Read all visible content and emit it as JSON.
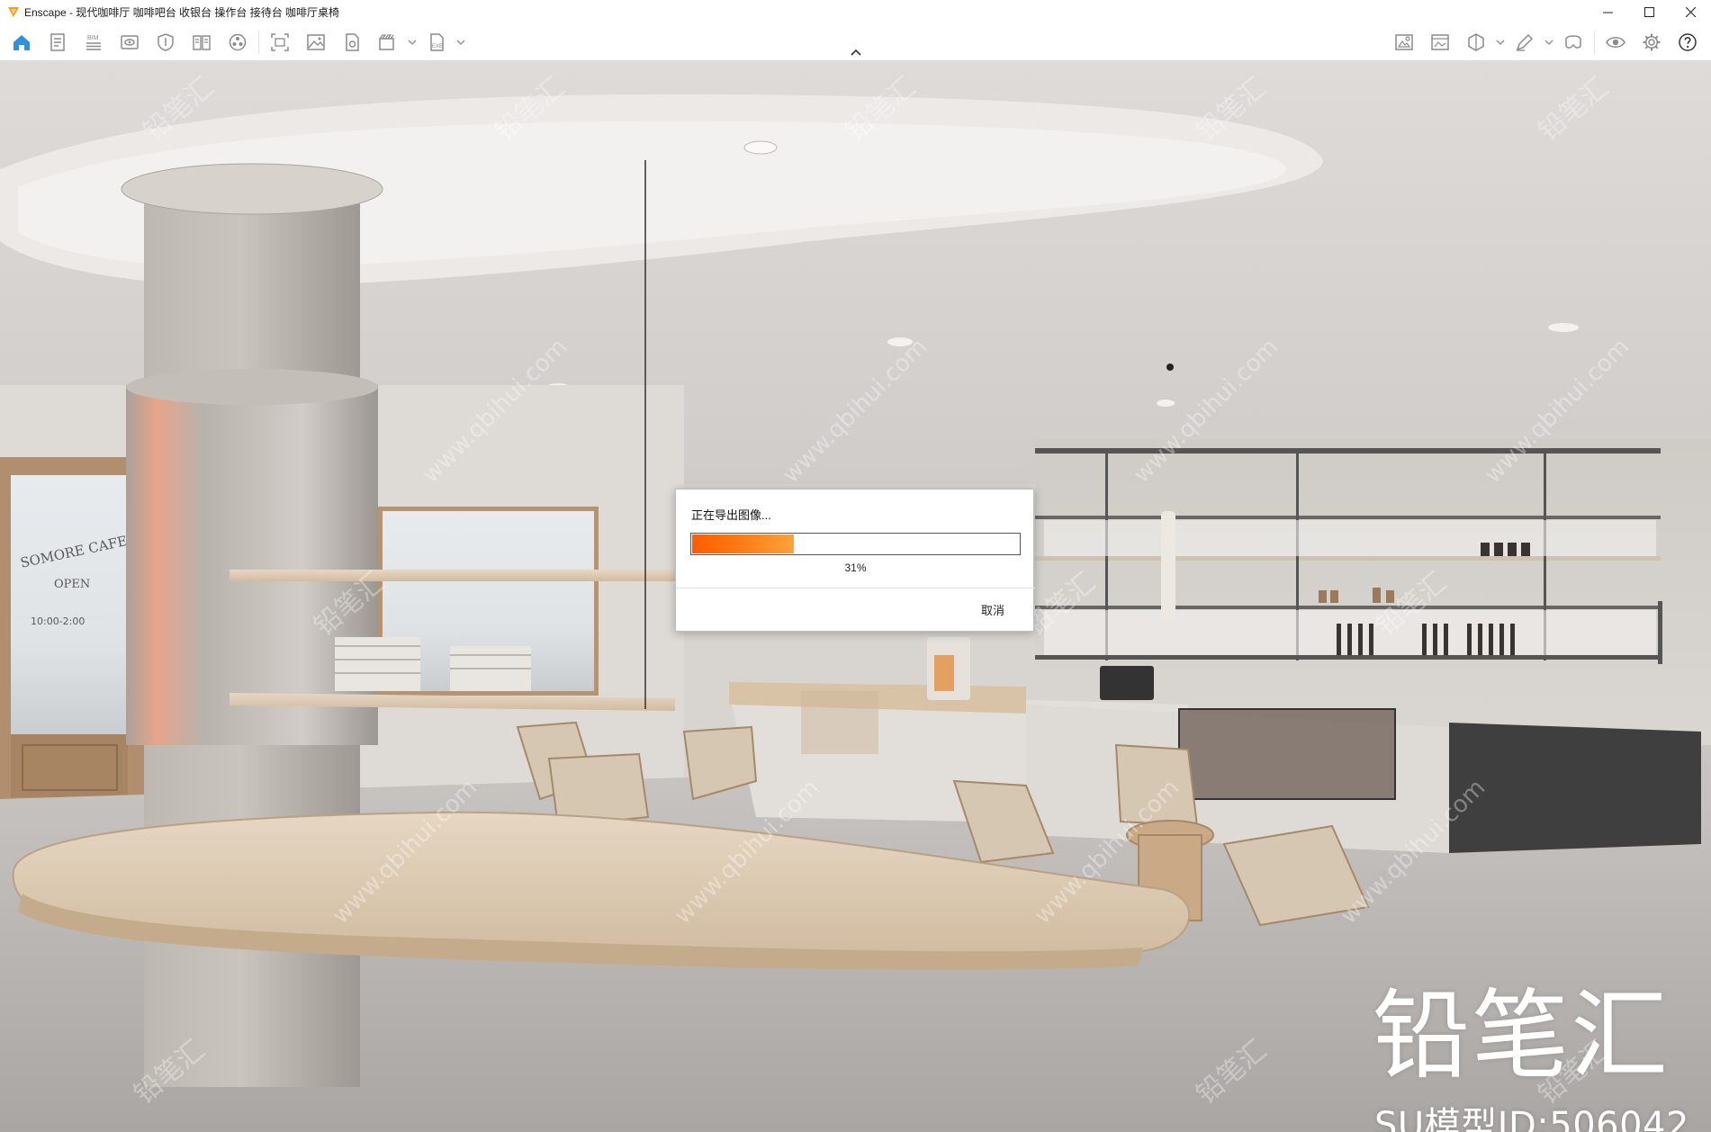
{
  "window": {
    "title": "Enscape - 现代咖啡厅 咖啡吧台 收银台 操作台 接待台 咖啡厅桌椅",
    "controls": [
      "minimize",
      "maximize",
      "close"
    ]
  },
  "toolbar": {
    "left_tools": [
      {
        "icon": "home-icon"
      },
      {
        "icon": "document-icon"
      },
      {
        "icon": "bim-icon",
        "label": "BIM"
      },
      {
        "icon": "eye-preview-icon"
      },
      {
        "icon": "shield-icon"
      },
      {
        "icon": "book-icon"
      },
      {
        "icon": "atom-icon"
      },
      {
        "icon": "capture-frame-icon"
      },
      {
        "icon": "image-icon"
      },
      {
        "icon": "file-settings-icon"
      },
      {
        "icon": "video-icon"
      },
      {
        "icon": "exe-export-icon",
        "label": "EXE"
      }
    ],
    "right_tools": [
      {
        "icon": "asset-library-icon"
      },
      {
        "icon": "screenshot-icon"
      },
      {
        "icon": "cube-section-icon"
      },
      {
        "icon": "pen-sketch-icon"
      },
      {
        "icon": "vr-headset-icon"
      },
      {
        "icon": "visual-settings-icon"
      },
      {
        "icon": "gear-icon"
      },
      {
        "icon": "help-icon"
      }
    ],
    "collapse_icon": "chevron-up-icon"
  },
  "viewport": {
    "door_sign": {
      "line1": "SOMORE CAFE",
      "line2": "OPEN",
      "line3": "10:00-2:00"
    },
    "watermark_brand": "铅笔汇",
    "watermark_id": "SU模型ID:506042",
    "watermark_pattern": [
      "铅笔汇",
      "www.qbihui.com"
    ]
  },
  "dialog": {
    "message": "正在导出图像...",
    "progress_percent": 31,
    "progress_label": "31%",
    "cancel_label": "取消",
    "progress_color": "#ff6a00"
  }
}
